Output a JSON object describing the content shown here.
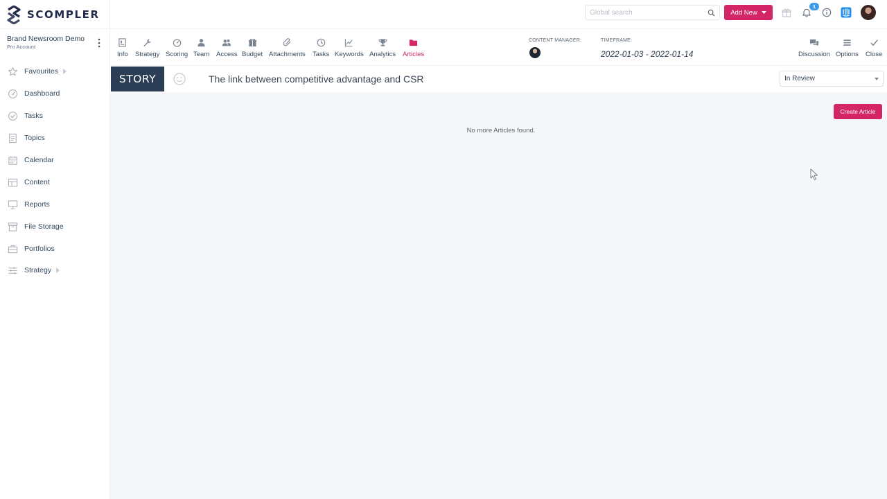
{
  "brand": {
    "name": "SCOMPLER"
  },
  "header": {
    "search_placeholder": "Global search",
    "add_new_label": "Add New",
    "notification_count": "1"
  },
  "account": {
    "name": "Brand Newsroom Demo",
    "plan": "Pro Account"
  },
  "sidebar": {
    "items": [
      {
        "label": "Favourites",
        "icon": "star-icon"
      },
      {
        "label": "Dashboard",
        "icon": "gauge-icon"
      },
      {
        "label": "Tasks",
        "icon": "check-circle-icon"
      },
      {
        "label": "Topics",
        "icon": "document-icon"
      },
      {
        "label": "Calendar",
        "icon": "calendar-icon"
      },
      {
        "label": "Content",
        "icon": "table-icon"
      },
      {
        "label": "Reports",
        "icon": "presentation-icon"
      },
      {
        "label": "File Storage",
        "icon": "archive-icon"
      },
      {
        "label": "Portfolios",
        "icon": "briefcase-icon"
      },
      {
        "label": "Strategy",
        "icon": "sliders-icon"
      }
    ]
  },
  "tabs": [
    {
      "label": "Info"
    },
    {
      "label": "Strategy"
    },
    {
      "label": "Scoring"
    },
    {
      "label": "Team"
    },
    {
      "label": "Access"
    },
    {
      "label": "Budget"
    },
    {
      "label": "Attachments"
    },
    {
      "label": "Tasks"
    },
    {
      "label": "Keywords"
    },
    {
      "label": "Analytics"
    },
    {
      "label": "Articles"
    }
  ],
  "meta": {
    "content_manager_label": "CONTENT MANAGER:",
    "timeframe_label": "TIMEFRAME:",
    "timeframe_value": "2022-01-03 - 2022-01-14"
  },
  "actions": {
    "discussion": "Discussion",
    "options": "Options",
    "close": "Close"
  },
  "story": {
    "badge": "STORY",
    "title": "The link between competitive advantage and CSR",
    "status": "In Review"
  },
  "articles": {
    "create_label": "Create Article",
    "empty_message": "No more Articles found."
  },
  "colors": {
    "accent": "#d42667",
    "story_badge": "#2b3e55",
    "badge_blue": "#3d9be9"
  }
}
